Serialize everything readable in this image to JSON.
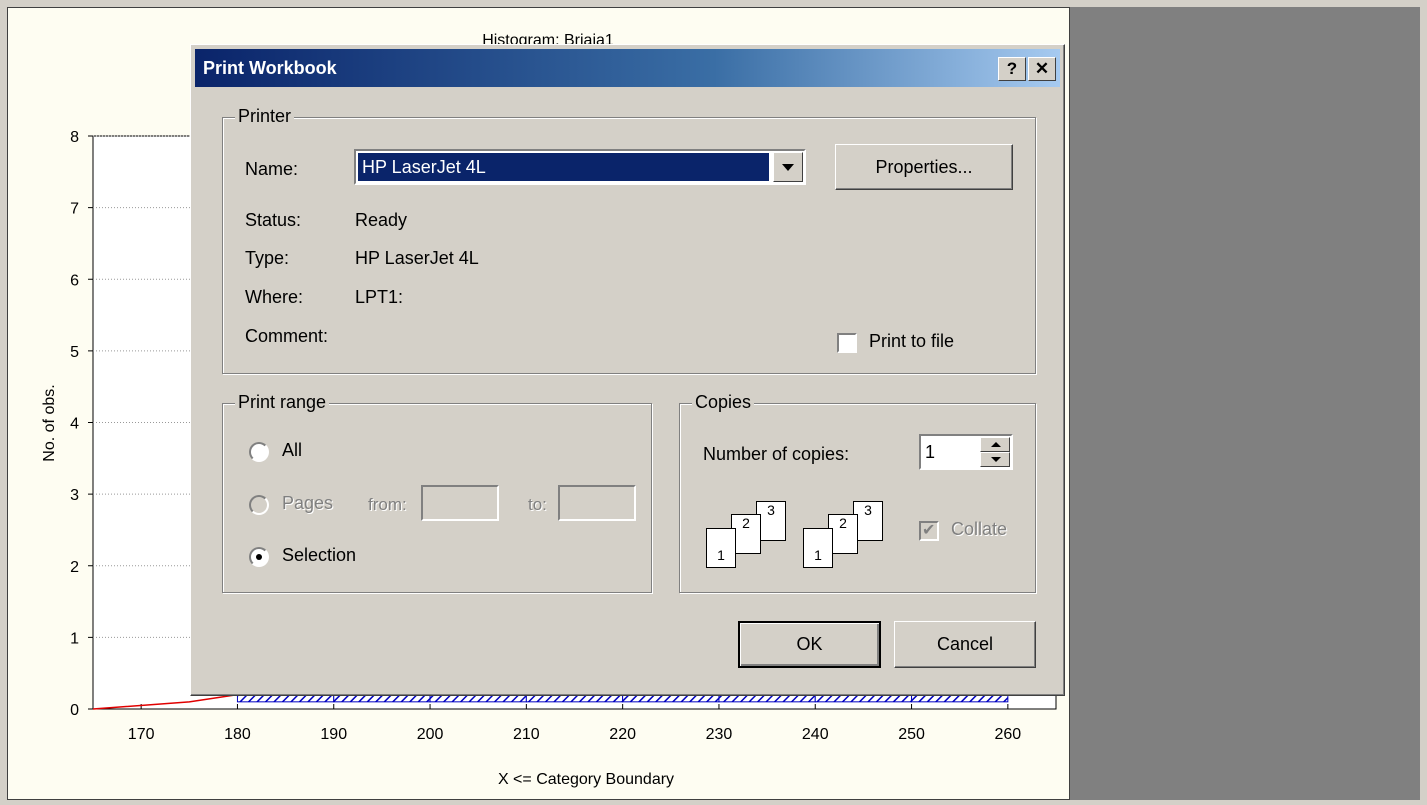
{
  "chart": {
    "title": "Histogram: Briaja1",
    "ylabel": "No. of obs.",
    "xlabel": "X <= Category Boundary"
  },
  "chart_data": {
    "type": "bar",
    "title": "Histogram: Briaja1",
    "xlabel": "X <= Category Boundary",
    "ylabel": "No. of obs.",
    "x_ticks": [
      "170",
      "180",
      "190",
      "200",
      "210",
      "220",
      "230",
      "240",
      "250",
      "260"
    ],
    "y_ticks": [
      "0",
      "1",
      "2",
      "3",
      "4",
      "5",
      "6",
      "7",
      "8"
    ],
    "ylim": [
      0,
      8
    ],
    "xlim": [
      165,
      265
    ],
    "grid": true,
    "series": [
      {
        "categories": [
          185,
          195,
          205,
          215,
          225,
          235,
          245,
          255
        ],
        "values": [
          0.1,
          0.1,
          0.1,
          0.1,
          0.1,
          0.1,
          0.1,
          0.1
        ]
      }
    ],
    "expected_normal_curve": [
      [
        165,
        0
      ],
      [
        175,
        0.1
      ],
      [
        180,
        0.2
      ]
    ]
  },
  "dialog": {
    "title": "Print Workbook",
    "help_label": "?",
    "close_label": "✕",
    "printer": {
      "group_label": "Printer",
      "name_label": "Name:",
      "name_value": "HP LaserJet 4L",
      "properties_label": "Properties...",
      "status_label": "Status:",
      "status_value": "Ready",
      "type_label": "Type:",
      "type_value": "HP LaserJet 4L",
      "where_label": "Where:",
      "where_value": "LPT1:",
      "comment_label": "Comment:",
      "print_to_file_label": "Print to file"
    },
    "range": {
      "group_label": "Print range",
      "all_label": "All",
      "pages_label": "Pages",
      "from_label": "from:",
      "to_label": "to:",
      "selection_label": "Selection"
    },
    "copies": {
      "group_label": "Copies",
      "number_label": "Number of copies:",
      "number_value": "1",
      "collate_label": "Collate",
      "page_numbers": [
        "1",
        "2",
        "3"
      ]
    },
    "ok_label": "OK",
    "cancel_label": "Cancel"
  }
}
